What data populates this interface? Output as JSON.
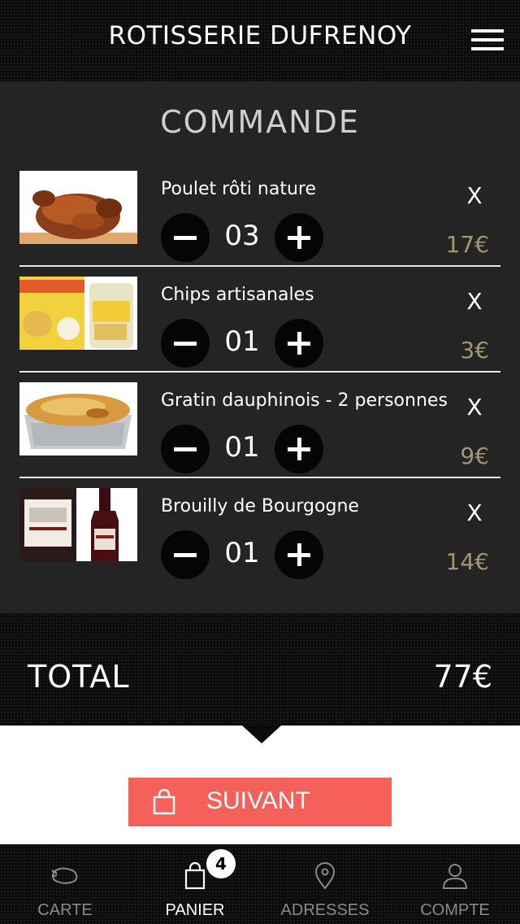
{
  "header": {
    "title": "ROTISSERIE DUFRENOY"
  },
  "order": {
    "heading": "COMMANDE",
    "remove_label": "X",
    "items": [
      {
        "name": "Poulet rôti nature",
        "quantity": "03",
        "price": "17€",
        "image": "roast-chicken"
      },
      {
        "name": "Chips artisanales",
        "quantity": "01",
        "price": "3€",
        "image": "chips-bags"
      },
      {
        "name": "Gratin dauphinois - 2 personnes",
        "quantity": "01",
        "price": "9€",
        "image": "gratin-tray"
      },
      {
        "name": "Brouilly de Bourgogne",
        "quantity": "01",
        "price": "14€",
        "image": "wine-bottle"
      }
    ]
  },
  "total": {
    "label": "TOTAL",
    "value": "77€"
  },
  "next_button": {
    "label": "SUIVANT"
  },
  "tabbar": {
    "badge": "4",
    "tabs": [
      {
        "label": "CARTE",
        "icon": "chicken-icon",
        "active": false
      },
      {
        "label": "PANIER",
        "icon": "bag-icon",
        "active": true
      },
      {
        "label": "ADRESSES",
        "icon": "location-pin-icon",
        "active": false
      },
      {
        "label": "COMPTE",
        "icon": "user-icon",
        "active": false
      }
    ]
  },
  "colors": {
    "accent": "#f5605a",
    "price": "#a39770",
    "panel": "#242424",
    "bar": "#0b0b0b"
  }
}
